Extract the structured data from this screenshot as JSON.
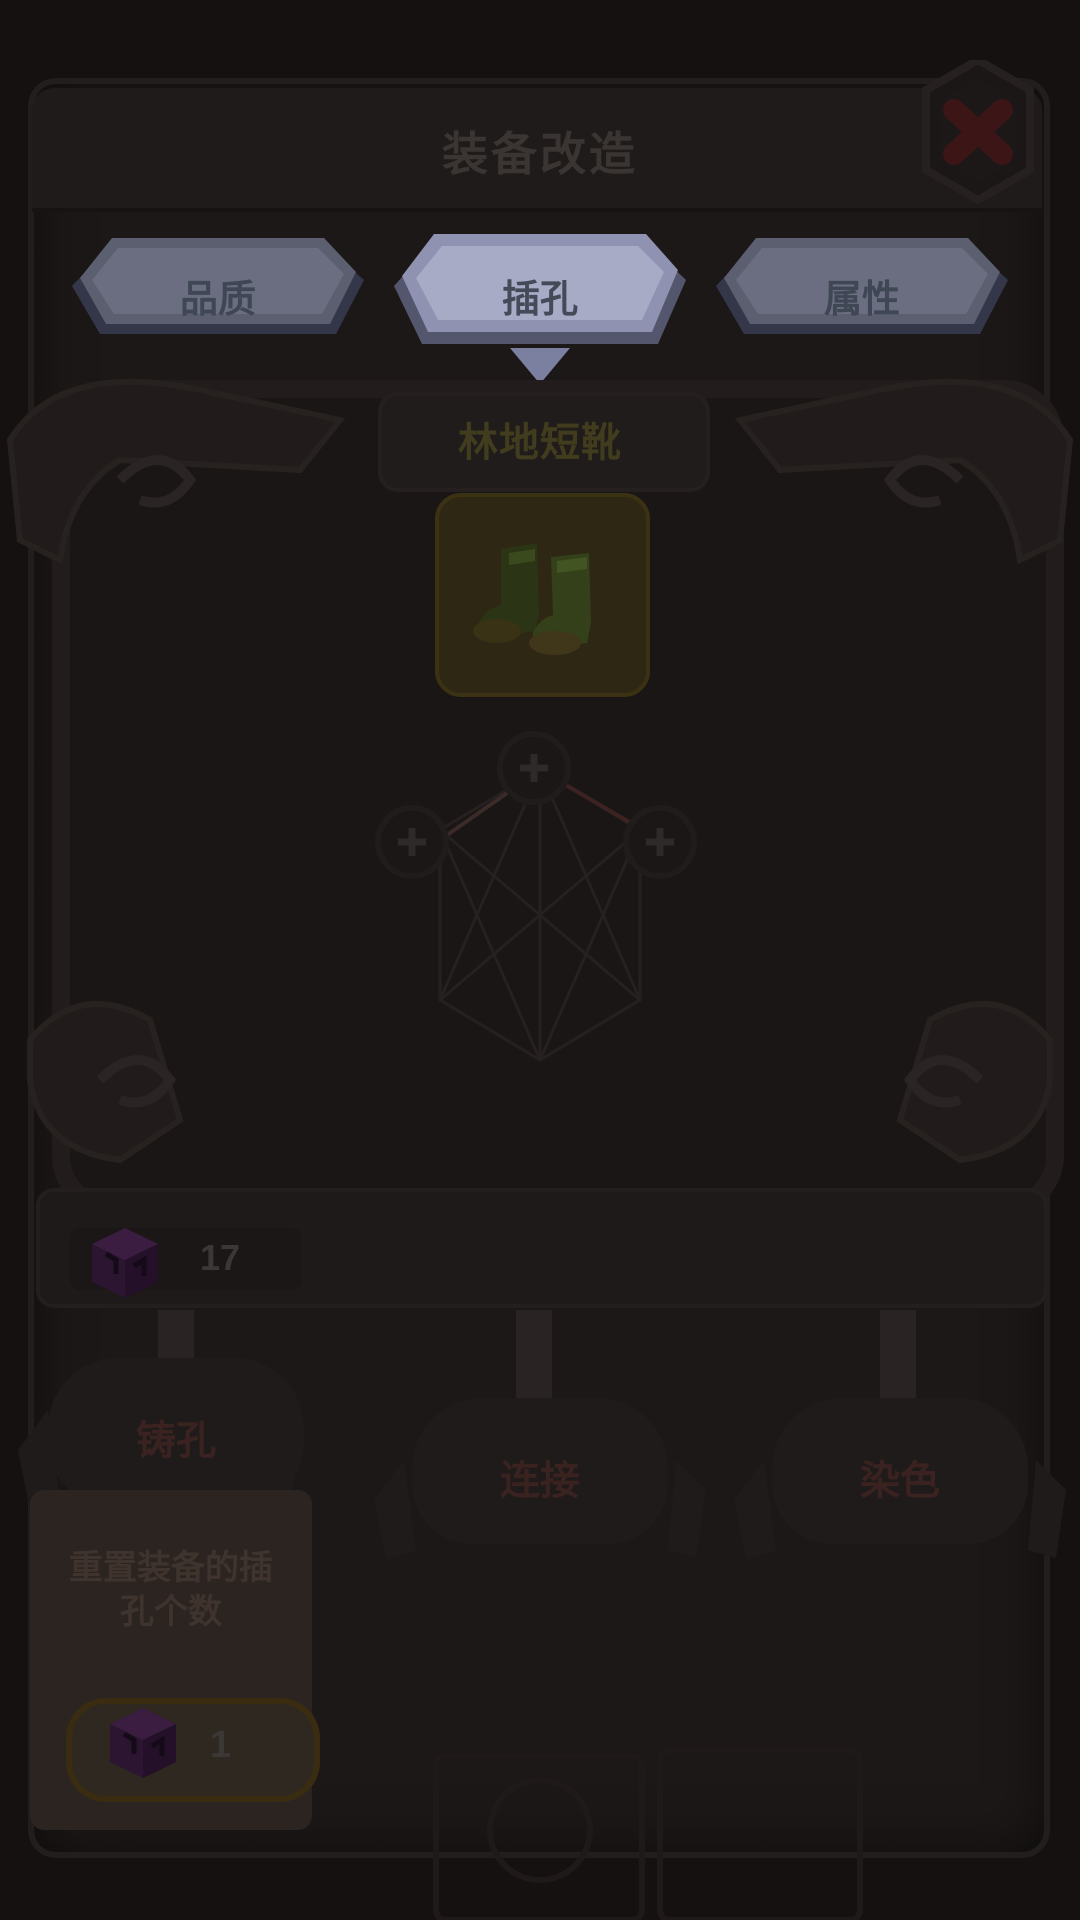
{
  "window": {
    "title": "装备改造"
  },
  "tabs": [
    {
      "label": "品质",
      "active": false
    },
    {
      "label": "插孔",
      "active": true
    },
    {
      "label": "属性",
      "active": false
    }
  ],
  "item": {
    "name": "林地短靴",
    "icon": "boots-icon"
  },
  "currency": {
    "icon": "purple-cube-icon",
    "count": "17"
  },
  "actions": [
    {
      "label": "铸孔"
    },
    {
      "label": "连接"
    },
    {
      "label": "染色"
    }
  ],
  "description": {
    "text": "重置装备的插孔个数",
    "cost": "1"
  },
  "colors": {
    "overlay_bg": "#141110",
    "tab_fill": "#5b5f70",
    "tab_active_fill": "#8f92b0",
    "item_slot_border": "#3b3213",
    "action_label": "#3a2220"
  }
}
